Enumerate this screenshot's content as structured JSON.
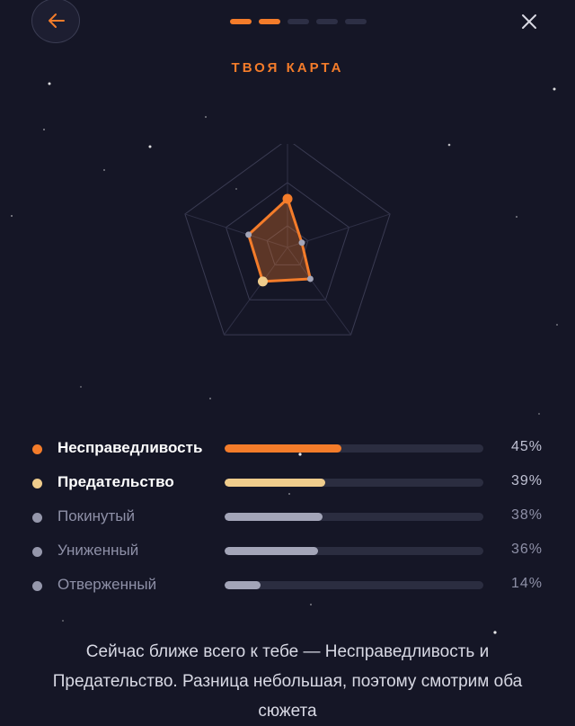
{
  "header": {
    "back_icon": "arrow-left-icon",
    "close_icon": "close-icon",
    "progress": {
      "total_steps": 5,
      "current_step": 2
    }
  },
  "title": "ТВОЯ КАРТА",
  "colors": {
    "accent": "#f47c2a",
    "secondary": "#efcc8c",
    "muted": "#9597ab",
    "background": "#151626"
  },
  "chart_data": {
    "type": "radar",
    "axes": [
      "Несправедливость",
      "Отверженный",
      "Униженный",
      "Предательство",
      "Покинутый"
    ],
    "values": [
      45,
      14,
      36,
      39,
      38
    ],
    "max": 100
  },
  "legend": [
    {
      "label": "Несправедливость",
      "percent": 45,
      "percent_text": "45%",
      "color": "#f47c2a",
      "highlight": true
    },
    {
      "label": "Предательство",
      "percent": 39,
      "percent_text": "39%",
      "color": "#efcc8c",
      "highlight": true
    },
    {
      "label": "Покинутый",
      "percent": 38,
      "percent_text": "38%",
      "color": "#9597ab",
      "highlight": false
    },
    {
      "label": "Униженный",
      "percent": 36,
      "percent_text": "36%",
      "color": "#9597ab",
      "highlight": false
    },
    {
      "label": "Отверженный",
      "percent": 14,
      "percent_text": "14%",
      "color": "#9597ab",
      "highlight": false
    }
  ],
  "summary": "Сейчас ближе всего к тебе — Несправедливость и Предательство. Разница небольшая, поэтому смотрим оба сюжета"
}
